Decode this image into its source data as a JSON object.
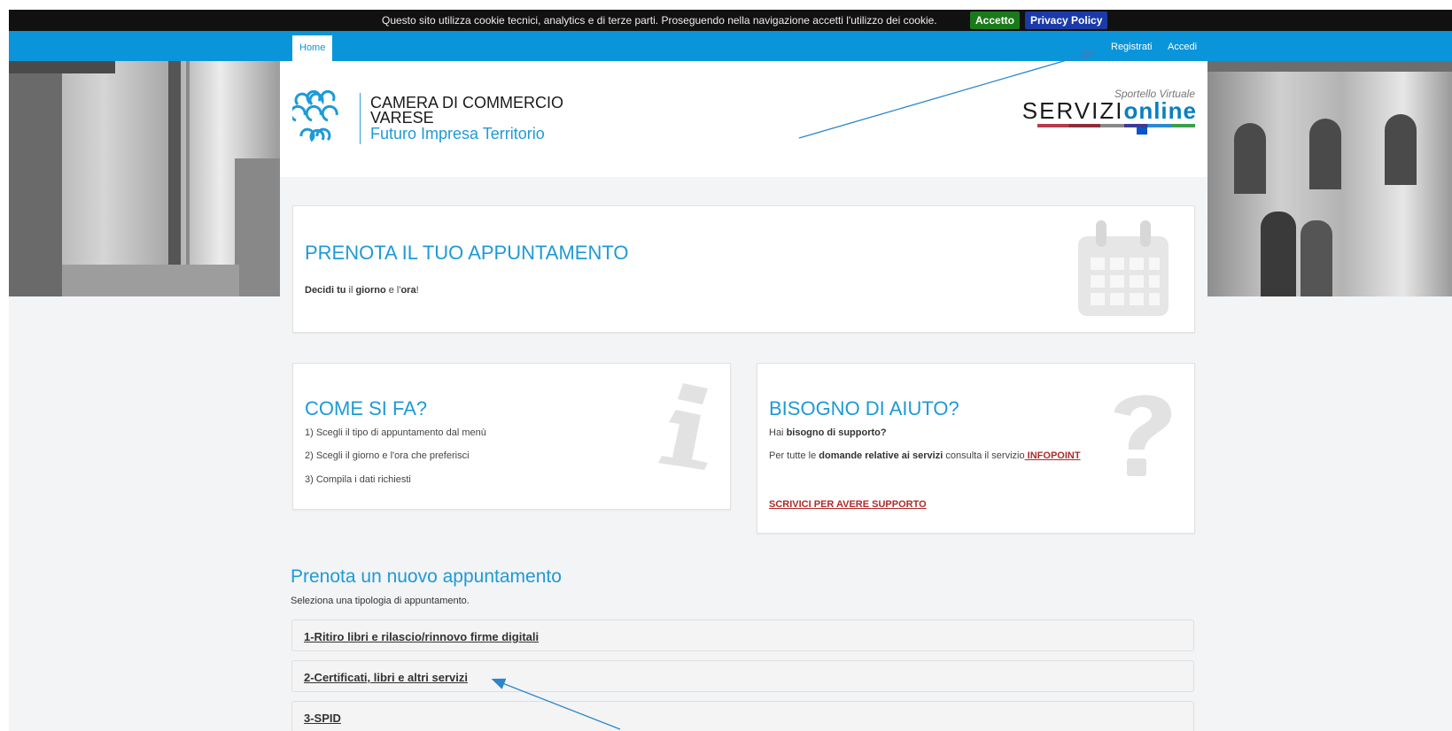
{
  "cookie_bar": {
    "text": "Questo sito utilizza cookie tecnici, analytics e di terze parti. Proseguendo nella navigazione accetti l'utilizzo dei cookie.",
    "accept_label": "Accetto",
    "privacy_label": "Privacy Policy"
  },
  "nav": {
    "home_label": "Home",
    "register_label": "Registrati",
    "login_label": "Accedi"
  },
  "header": {
    "logo_line1": "CAMERA DI COMMERCIO",
    "logo_line2": "VARESE",
    "logo_line3": "Futuro Impresa Territorio",
    "servizi_small": "Sportello Virtuale",
    "servizi_prefix": "SERVIZI",
    "servizi_suffix": "online"
  },
  "book_card": {
    "title": "PRENOTA IL TUO APPUNTAMENTO",
    "text_b1": "Decidi tu",
    "text_t1": " il ",
    "text_b2": "giorno",
    "text_t2": " e l'",
    "text_b3": "ora",
    "text_t3": "!"
  },
  "howto_card": {
    "title": "COME SI FA?",
    "steps": [
      "1) Scegli il tipo di appuntamento dal menù",
      "2) Scegli il giorno e l'ora che preferisci",
      "3) Compila i dati richiesti"
    ]
  },
  "help_card": {
    "title": "BISOGNO DI AIUTO?",
    "line1_t": "Hai ",
    "line1_b": "bisogno di supporto?",
    "line2_t1": "Per tutte le ",
    "line2_b": "domande relative ai servizi",
    "line2_t2": " consulta il servizio",
    "infopoint_label": " INFOPOINT",
    "support_link": "SCRIVICI PER AVERE SUPPORTO"
  },
  "booking": {
    "title": "Prenota un nuovo appuntamento",
    "subtitle": "Seleziona una tipologia di appuntamento.",
    "items": [
      "1-Ritiro libri e rilascio/rinnovo firme digitali",
      "2-Certificati, libri e altri servizi",
      "3-SPID"
    ]
  },
  "colors": {
    "nav_blue": "#0a95db",
    "title_blue": "#1e9ad6",
    "link_red": "#b02a2a",
    "accept_green": "#1a7a1a",
    "privacy_blue": "#1a3aa8"
  }
}
